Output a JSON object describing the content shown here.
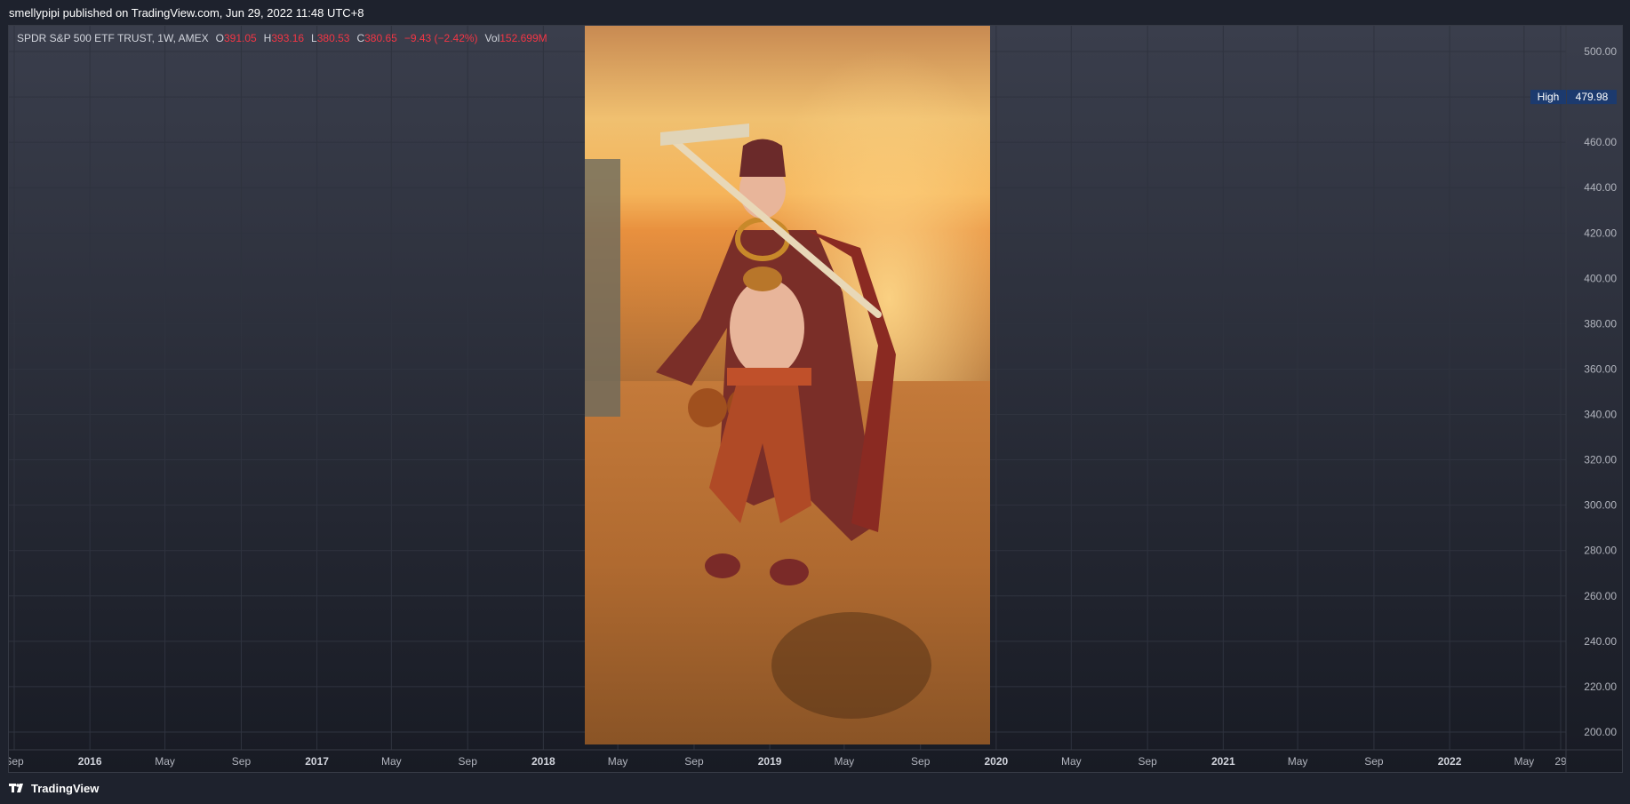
{
  "header": {
    "published_text": "smellypipi published on TradingView.com, Jun 29, 2022 11:48 UTC+8"
  },
  "legend": {
    "symbol": "SPDR S&P 500 ETF TRUST, 1W, AMEX",
    "o_label": "O",
    "o_value": "391.05",
    "h_label": "H",
    "h_value": "393.16",
    "l_label": "L",
    "l_value": "380.53",
    "c_label": "C",
    "c_value": "380.65",
    "change": "−9.43 (−2.42%)",
    "vol_label": "Vol",
    "vol_value": "152.699M"
  },
  "footer": {
    "brand": "TradingView"
  },
  "colors": {
    "background_top": "#3a3e4c",
    "background_bottom": "#181b24",
    "grid": "#2f333f",
    "axis_text": "#b2b5be",
    "negative": "#f23645",
    "high_badge": "#1c3a6e"
  },
  "chart_data": {
    "type": "line",
    "ylim": [
      190,
      505
    ],
    "yticks": [
      200,
      220,
      240,
      260,
      280,
      300,
      320,
      340,
      360,
      380,
      400,
      420,
      440,
      460,
      500
    ],
    "ytick_labels": [
      "200.00",
      "220.00",
      "240.00",
      "260.00",
      "280.00",
      "300.00",
      "320.00",
      "340.00",
      "360.00",
      "380.00",
      "400.00",
      "420.00",
      "440.00",
      "460.00",
      "500.00"
    ],
    "xlim": [
      "2015-09-01",
      "2022-06-29"
    ],
    "xticks": [
      {
        "date": "2015-09-01",
        "label": "Sep",
        "major": false
      },
      {
        "date": "2016-01-01",
        "label": "2016",
        "major": true
      },
      {
        "date": "2016-05-01",
        "label": "May",
        "major": false
      },
      {
        "date": "2016-09-01",
        "label": "Sep",
        "major": false
      },
      {
        "date": "2017-01-01",
        "label": "2017",
        "major": true
      },
      {
        "date": "2017-05-01",
        "label": "May",
        "major": false
      },
      {
        "date": "2017-09-01",
        "label": "Sep",
        "major": false
      },
      {
        "date": "2018-01-01",
        "label": "2018",
        "major": true
      },
      {
        "date": "2018-05-01",
        "label": "May",
        "major": false
      },
      {
        "date": "2018-09-01",
        "label": "Sep",
        "major": false
      },
      {
        "date": "2019-01-01",
        "label": "2019",
        "major": true
      },
      {
        "date": "2019-05-01",
        "label": "May",
        "major": false
      },
      {
        "date": "2019-09-01",
        "label": "Sep",
        "major": false
      },
      {
        "date": "2020-01-01",
        "label": "2020",
        "major": true
      },
      {
        "date": "2020-05-01",
        "label": "May",
        "major": false
      },
      {
        "date": "2020-09-01",
        "label": "Sep",
        "major": false
      },
      {
        "date": "2021-01-01",
        "label": "2021",
        "major": true
      },
      {
        "date": "2021-05-01",
        "label": "May",
        "major": false
      },
      {
        "date": "2021-09-01",
        "label": "Sep",
        "major": false
      },
      {
        "date": "2022-01-01",
        "label": "2022",
        "major": true
      },
      {
        "date": "2022-05-01",
        "label": "May",
        "major": false
      },
      {
        "date": "2022-06-29",
        "label": "29",
        "major": false
      }
    ],
    "annotations": [
      {
        "label": "High",
        "value": 479.98,
        "value_label": "479.98"
      }
    ],
    "grid": true
  }
}
